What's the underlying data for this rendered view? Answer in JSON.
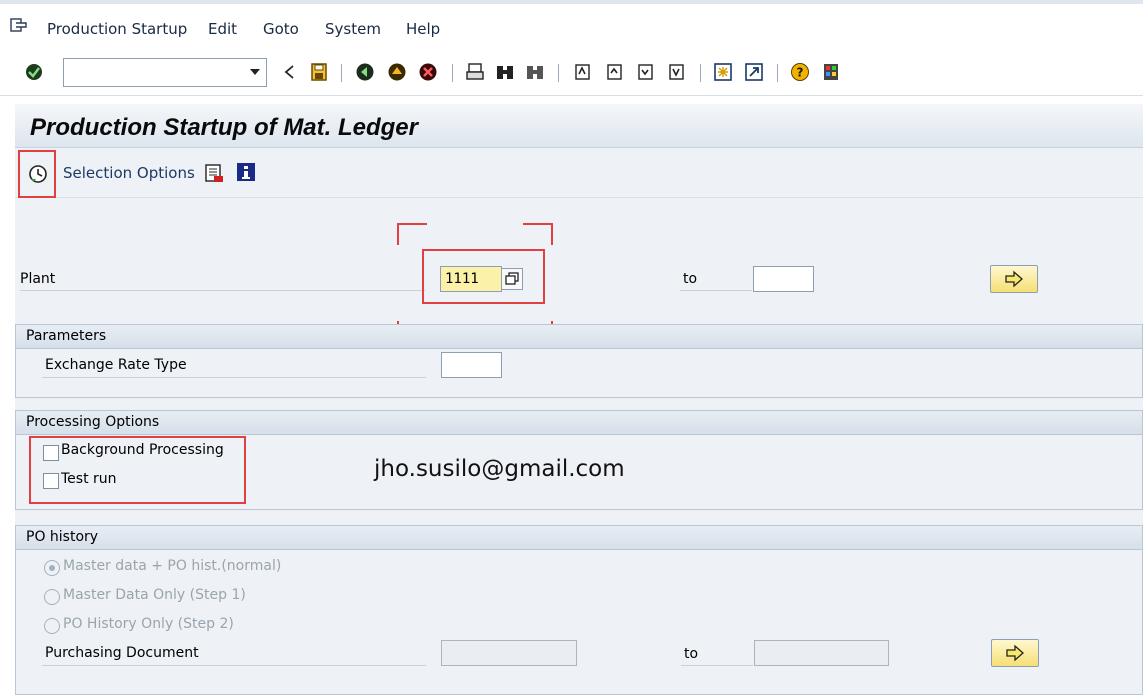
{
  "menu": {
    "items": [
      {
        "label": "Production Startup"
      },
      {
        "label": "Edit"
      },
      {
        "label": "Goto"
      },
      {
        "label": "System"
      },
      {
        "label": "Help"
      }
    ]
  },
  "toolbar": {
    "command_field": {
      "value": "",
      "placeholder": ""
    },
    "icons": [
      "enter-check-icon",
      "back-nav-icon",
      "save-icon",
      "back-icon",
      "exit-icon",
      "cancel-icon",
      "print-icon",
      "find-icon",
      "find-next-icon",
      "first-page-icon",
      "previous-page-icon",
      "next-page-icon",
      "last-page-icon",
      "create-session-icon",
      "shortcut-icon",
      "help-icon",
      "layout-menu-icon"
    ]
  },
  "title": "Production Startup of Mat. Ledger",
  "application_toolbar": {
    "selection_options_label": "Selection Options"
  },
  "selection": {
    "plant_label": "Plant",
    "plant_value": "1111",
    "to_label": "to",
    "plant_to_value": ""
  },
  "parameters": {
    "title": "Parameters",
    "exchange_rate_label": "Exchange Rate Type",
    "exchange_rate_value": ""
  },
  "processing_options": {
    "title": "Processing Options",
    "background_processing_label": "Background Processing",
    "test_run_label": "Test run"
  },
  "watermark": "jho.susilo@gmail.com",
  "po_history": {
    "title": "PO history",
    "options": [
      {
        "label": "Master data + PO hist.(normal)",
        "selected": true
      },
      {
        "label": "Master Data Only (Step 1)",
        "selected": false
      },
      {
        "label": "PO History Only (Step 2)",
        "selected": false
      }
    ],
    "purchasing_document_label": "Purchasing Document",
    "to_label": "to"
  },
  "colors": {
    "highlight_red": "#e04040",
    "required_field": "#fbf1a8",
    "screen_background": "#eef2f6"
  }
}
